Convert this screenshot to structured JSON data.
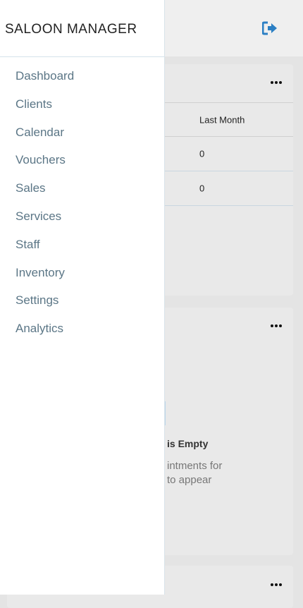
{
  "app": {
    "title": "SALOON MANAGER",
    "logout_icon": "sign-out-icon",
    "accent": "#2b7fc4"
  },
  "drawer": {
    "items": [
      {
        "label": "Dashboard"
      },
      {
        "label": "Clients"
      },
      {
        "label": "Calendar"
      },
      {
        "label": "Vouchers"
      },
      {
        "label": "Sales"
      },
      {
        "label": "Services"
      },
      {
        "label": "Staff"
      },
      {
        "label": "Inventory"
      },
      {
        "label": "Settings"
      },
      {
        "label": "Analytics"
      }
    ]
  },
  "card1": {
    "column_header": "Last Month",
    "values": [
      "0",
      "0"
    ]
  },
  "card2": {
    "empty_title": "is Empty",
    "empty_text": "intments for\nto appear"
  }
}
